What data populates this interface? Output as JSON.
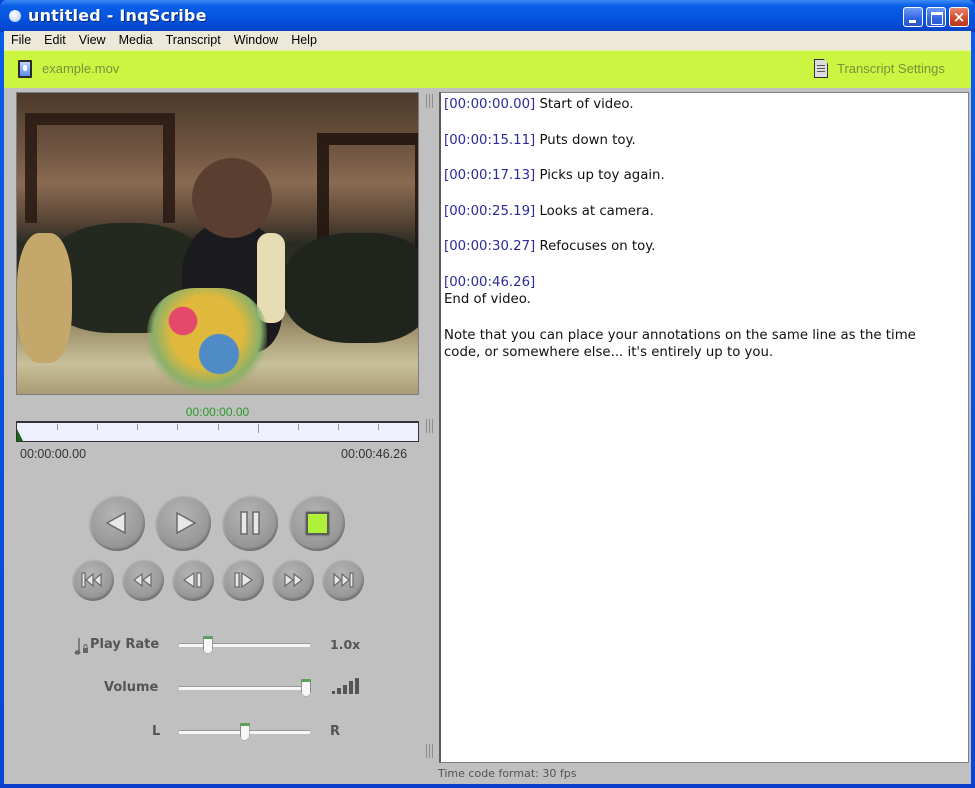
{
  "window": {
    "title": "untitled - InqScribe",
    "controls": {
      "minimize": "minimize",
      "maximize": "maximize",
      "close": "×"
    }
  },
  "menu": [
    "File",
    "Edit",
    "View",
    "Media",
    "Transcript",
    "Window",
    "Help"
  ],
  "toolbar": {
    "media_file": "example.mov",
    "media_icon": "movie-file-icon",
    "settings_label": "Transcript Settings",
    "settings_icon": "document-icon",
    "accent_color": "#ccf542"
  },
  "player": {
    "current_time": "00:00:00.00",
    "start_time": "00:00:00.00",
    "end_time": "00:00:46.26",
    "playhead_position": 0.0,
    "transport_main": [
      "rewind-play",
      "play",
      "pause",
      "stop"
    ],
    "transport_secondary": [
      "go-to-start",
      "fast-rewind",
      "step-back",
      "step-forward",
      "fast-forward",
      "go-to-end"
    ],
    "sliders": {
      "play_rate": {
        "label": "Play Rate",
        "value_label": "1.0x",
        "position": 0.22
      },
      "volume": {
        "label": "Volume",
        "position": 0.97
      },
      "balance": {
        "left_label": "L",
        "right_label": "R",
        "position": 0.5
      }
    }
  },
  "transcript": {
    "entries": [
      {
        "timecode": "[00:00:00.00]",
        "text": " Start of video.",
        "newline": false
      },
      {
        "timecode": "[00:00:15.11]",
        "text": " Puts down toy.",
        "newline": false
      },
      {
        "timecode": "[00:00:17.13]",
        "text": " Picks up toy again.",
        "newline": false
      },
      {
        "timecode": "[00:00:25.19]",
        "text": " Looks at camera.",
        "newline": false
      },
      {
        "timecode": "[00:00:30.27]",
        "text": " Refocuses on toy.",
        "newline": false
      },
      {
        "timecode": "[00:00:46.26]",
        "text": "End of video.",
        "newline": true
      }
    ],
    "note": "Note that you can place your annotations on the same line as the time code, or somewhere else... it's entirely up to you.",
    "timecode_color": "#2b2b9a"
  },
  "status_bar": {
    "text": "Time code format: 30 fps"
  }
}
